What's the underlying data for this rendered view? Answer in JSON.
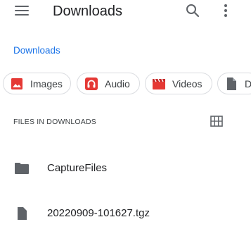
{
  "appbar": {
    "title": "Downloads",
    "menu_icon": "hamburger-menu-icon",
    "search_icon": "search-icon",
    "more_icon": "more-vert-icon"
  },
  "breadcrumb": {
    "label": "Downloads"
  },
  "chips": [
    {
      "label": "Images",
      "icon": "image-icon",
      "color": "#e53935"
    },
    {
      "label": "Audio",
      "icon": "audio-icon",
      "color": "#e53935"
    },
    {
      "label": "Videos",
      "icon": "video-icon",
      "color": "#e53935"
    },
    {
      "label": "D",
      "icon": "document-icon",
      "color": "#5f6368"
    }
  ],
  "section": {
    "label": "FILES IN DOWNLOADS",
    "view_icon": "grid-view-icon"
  },
  "files": [
    {
      "name": "CaptureFiles",
      "icon": "folder-icon"
    },
    {
      "name": "20220909-101627.tgz",
      "icon": "file-icon"
    }
  ],
  "colors": {
    "accent": "#1a73e8",
    "icon_gray": "#5f6368",
    "chip_red": "#e53935"
  }
}
